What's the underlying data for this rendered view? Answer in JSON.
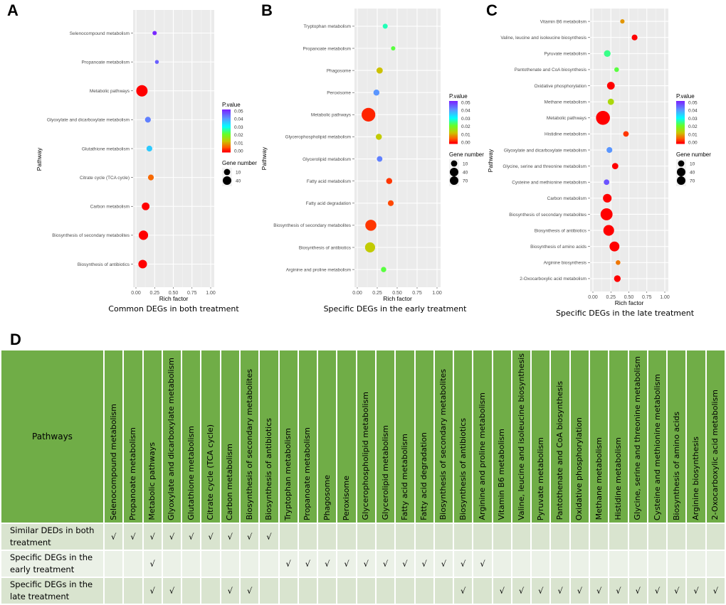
{
  "panels": {
    "A": "A",
    "B": "B",
    "C": "C",
    "D": "D"
  },
  "chart_data": [
    {
      "type": "scatter",
      "panel": "A",
      "title": "Common DEGs in both treatment",
      "xlabel": "Rich factor",
      "ylabel": "Pathway",
      "xlim": [
        0,
        1
      ],
      "xticks": [
        "0.00",
        "0.25",
        "0.50",
        "0.75",
        "1.00"
      ],
      "grid": true,
      "legend_position": "right",
      "color_legend": {
        "title": "P.value",
        "ticks": [
          "0.05",
          "0.04",
          "0.03",
          "0.02",
          "0.01",
          "0.00"
        ],
        "range": [
          0,
          0.05
        ]
      },
      "size_legend": {
        "title": "Gene number",
        "values": [
          10,
          40
        ]
      },
      "points": [
        {
          "pathway": "Selenocompound metabolism",
          "rich_factor": 0.25,
          "p_value": 0.05,
          "gene_number": 3
        },
        {
          "pathway": "Propanoate metabolism",
          "rich_factor": 0.28,
          "p_value": 0.045,
          "gene_number": 2
        },
        {
          "pathway": "Metabolic pathways",
          "rich_factor": 0.08,
          "p_value": 0.0,
          "gene_number": 48
        },
        {
          "pathway": "Glyoxylate and dicarboxylate metabolism",
          "rich_factor": 0.16,
          "p_value": 0.042,
          "gene_number": 8
        },
        {
          "pathway": "Glutathione metabolism",
          "rich_factor": 0.18,
          "p_value": 0.035,
          "gene_number": 8
        },
        {
          "pathway": "Citrate cycle (TCA cycle)",
          "rich_factor": 0.2,
          "p_value": 0.006,
          "gene_number": 8
        },
        {
          "pathway": "Carbon metabolism",
          "rich_factor": 0.13,
          "p_value": 0.0,
          "gene_number": 18
        },
        {
          "pathway": "Biosynthesis of secondary metabolites",
          "rich_factor": 0.1,
          "p_value": 0.0,
          "gene_number": 30
        },
        {
          "pathway": "Biosynthesis of antibiotics",
          "rich_factor": 0.09,
          "p_value": 0.0,
          "gene_number": 24
        }
      ]
    },
    {
      "type": "scatter",
      "panel": "B",
      "title": "Specific DEGs in the early treatment",
      "xlabel": "Rich factor",
      "ylabel": "Pathway",
      "xlim": [
        0,
        1
      ],
      "xticks": [
        "0.00",
        "0.25",
        "0.50",
        "0.75",
        "1.00"
      ],
      "grid": true,
      "legend_position": "right",
      "color_legend": {
        "title": "P.value",
        "ticks": [
          "0.05",
          "0.04",
          "0.03",
          "0.02",
          "0.01",
          "0.00"
        ],
        "range": [
          0,
          0.05
        ]
      },
      "size_legend": {
        "title": "Gene number",
        "values": [
          10,
          40,
          70
        ]
      },
      "points": [
        {
          "pathway": "Tryptophan metabolism",
          "rich_factor": 0.35,
          "p_value": 0.027,
          "gene_number": 5
        },
        {
          "pathway": "Propanoate metabolism",
          "rich_factor": 0.45,
          "p_value": 0.022,
          "gene_number": 3
        },
        {
          "pathway": "Phagosome",
          "rich_factor": 0.28,
          "p_value": 0.012,
          "gene_number": 10
        },
        {
          "pathway": "Peroxisome",
          "rich_factor": 0.24,
          "p_value": 0.04,
          "gene_number": 9
        },
        {
          "pathway": "Metabolic pathways",
          "rich_factor": 0.14,
          "p_value": 0.002,
          "gene_number": 75
        },
        {
          "pathway": "Glycerophospholipid metabolism",
          "rich_factor": 0.27,
          "p_value": 0.013,
          "gene_number": 9
        },
        {
          "pathway": "Glycerolipid metabolism",
          "rich_factor": 0.28,
          "p_value": 0.042,
          "gene_number": 7
        },
        {
          "pathway": "Fatty acid metabolism",
          "rich_factor": 0.4,
          "p_value": 0.003,
          "gene_number": 9
        },
        {
          "pathway": "Fatty acid degradation",
          "rich_factor": 0.42,
          "p_value": 0.004,
          "gene_number": 8
        },
        {
          "pathway": "Biosynthesis of secondary metabolites",
          "rich_factor": 0.17,
          "p_value": 0.003,
          "gene_number": 45
        },
        {
          "pathway": "Biosynthesis of antibiotics",
          "rich_factor": 0.16,
          "p_value": 0.013,
          "gene_number": 36
        },
        {
          "pathway": "Arginine and proline metabolism",
          "rich_factor": 0.33,
          "p_value": 0.022,
          "gene_number": 6
        }
      ]
    },
    {
      "type": "scatter",
      "panel": "C",
      "title": "Specific DEGs in the late treatment",
      "xlabel": "Rich factor",
      "ylabel": "Pathway",
      "xlim": [
        0,
        1
      ],
      "xticks": [
        "0.00",
        "0.25",
        "0.50",
        "0.75",
        "1.00"
      ],
      "grid": true,
      "legend_position": "right",
      "color_legend": {
        "title": "P.value",
        "ticks": [
          "0.05",
          "0.04",
          "0.03",
          "0.02",
          "0.01",
          "0.00"
        ],
        "range": [
          0,
          0.05
        ]
      },
      "size_legend": {
        "title": "Gene number",
        "values": [
          10,
          40,
          70
        ]
      },
      "points": [
        {
          "pathway": "Vitamin B6 metabolism",
          "rich_factor": 0.41,
          "p_value": 0.009,
          "gene_number": 3
        },
        {
          "pathway": "Valine, leucine and isoleucine biosynthesis",
          "rich_factor": 0.58,
          "p_value": 0.0,
          "gene_number": 8
        },
        {
          "pathway": "Pyruvate metabolism",
          "rich_factor": 0.2,
          "p_value": 0.025,
          "gene_number": 12
        },
        {
          "pathway": "Pantothenate and CoA biosynthesis",
          "rich_factor": 0.33,
          "p_value": 0.022,
          "gene_number": 4
        },
        {
          "pathway": "Oxidative phosphorylation",
          "rich_factor": 0.25,
          "p_value": 0.0,
          "gene_number": 18
        },
        {
          "pathway": "Methane metabolism",
          "rich_factor": 0.25,
          "p_value": 0.015,
          "gene_number": 10
        },
        {
          "pathway": "Metabolic pathways",
          "rich_factor": 0.14,
          "p_value": 0.0,
          "gene_number": 78
        },
        {
          "pathway": "Histidine metabolism",
          "rich_factor": 0.46,
          "p_value": 0.003,
          "gene_number": 7
        },
        {
          "pathway": "Glyoxylate and dicarboxylate metabolism",
          "rich_factor": 0.23,
          "p_value": 0.04,
          "gene_number": 8
        },
        {
          "pathway": "Glycine, serine and threonine metabolism",
          "rich_factor": 0.31,
          "p_value": 0.0,
          "gene_number": 10
        },
        {
          "pathway": "Cysteine and methionine metabolism",
          "rich_factor": 0.19,
          "p_value": 0.046,
          "gene_number": 7
        },
        {
          "pathway": "Carbon metabolism",
          "rich_factor": 0.2,
          "p_value": 0.0,
          "gene_number": 24
        },
        {
          "pathway": "Biosynthesis of secondary metabolites",
          "rich_factor": 0.19,
          "p_value": 0.0,
          "gene_number": 55
        },
        {
          "pathway": "Biosynthesis of antibiotics",
          "rich_factor": 0.22,
          "p_value": 0.0,
          "gene_number": 42
        },
        {
          "pathway": "Biosynthesis of amino acids",
          "rich_factor": 0.3,
          "p_value": 0.0,
          "gene_number": 34
        },
        {
          "pathway": "Arginine biosynthesis",
          "rich_factor": 0.35,
          "p_value": 0.007,
          "gene_number": 4
        },
        {
          "pathway": "2-Oxocarboxylic acid metabolism",
          "rich_factor": 0.34,
          "p_value": 0.0,
          "gene_number": 12
        }
      ]
    },
    {
      "type": "table",
      "panel": "D",
      "header_label": "Pathways",
      "columns": [
        "Selenocompound metabolism",
        "Propanoate metabolism",
        "Metabolic pathways",
        "Glyoxylate and dicarboxylate metabolism",
        "Glutathione metabolism",
        "Citrate cycle (TCA cycle)",
        "Carbon metabolism",
        "Biosynthesis of secondary metabolites",
        "Biosynthesis of antibiotics",
        "Tryptophan metabolism",
        "Propanoate metabolism",
        "Phagosome",
        "Peroxisome",
        "Glycerophospholipid metabolism",
        "Glycerolipid metabolism",
        "Fatty acid metabolism",
        "Fatty acid degradation",
        "Biosynthesis of secondary metabolites",
        "Biosynthesis of antibiotics",
        "Arginine and proline metabolism",
        "Vitamin B6 metabolism",
        "Valine, leucine and isoleucine biosynthesis",
        "Pyruvate metabolism",
        "Pantothenate and CoA biosynthesis",
        "Oxidative phosphorylation",
        "Methane metabolism",
        "Histidine metabolism",
        "Glycine, serine and threonine metabolism",
        "Cysteine and methionine metabolism",
        "Biosynthesis of amino acids",
        "Arginine biosynthesis",
        "2-Oxocarboxylic acid metabolism"
      ],
      "check_symbol": "√",
      "rows": [
        {
          "label": "Similar DEDs in both treatment",
          "checks": [
            1,
            1,
            1,
            1,
            1,
            1,
            1,
            1,
            1,
            0,
            0,
            0,
            0,
            0,
            0,
            0,
            0,
            0,
            0,
            0,
            0,
            0,
            0,
            0,
            0,
            0,
            0,
            0,
            0,
            0,
            0,
            0
          ]
        },
        {
          "label": "Specific DEGs in the early treatment",
          "checks": [
            0,
            0,
            1,
            0,
            0,
            0,
            0,
            0,
            0,
            1,
            1,
            1,
            1,
            1,
            1,
            1,
            1,
            1,
            1,
            1,
            0,
            0,
            0,
            0,
            0,
            0,
            0,
            0,
            0,
            0,
            0,
            0
          ]
        },
        {
          "label": "Specific DEGs in the late treatment",
          "checks": [
            0,
            0,
            1,
            1,
            0,
            0,
            1,
            1,
            0,
            0,
            0,
            0,
            0,
            0,
            0,
            0,
            0,
            0,
            1,
            0,
            1,
            1,
            1,
            1,
            1,
            1,
            1,
            1,
            1,
            1,
            1,
            1
          ]
        }
      ]
    }
  ]
}
